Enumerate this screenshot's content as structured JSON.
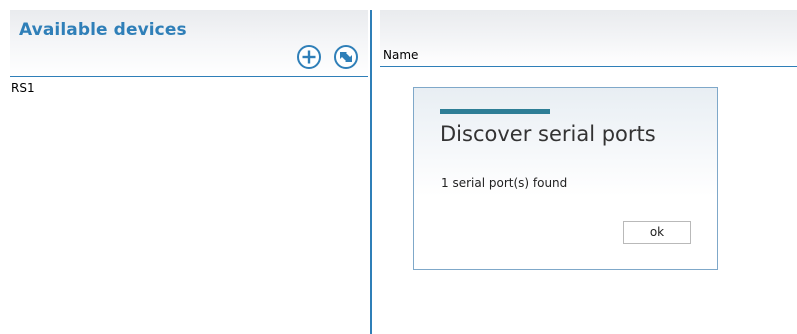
{
  "left_panel": {
    "title": "Available devices",
    "toolbar": {
      "add_icon": "add-circle-icon",
      "refresh_icon": "refresh-circle-icon"
    },
    "devices": [
      "RS1"
    ]
  },
  "right_panel": {
    "columns": [
      "Name"
    ]
  },
  "dialog": {
    "title": "Discover serial ports",
    "message": "1 serial port(s) found",
    "ok_label": "ok"
  },
  "colors": {
    "accent": "#2f7fb8",
    "dialog_accent": "#2e7e96"
  }
}
